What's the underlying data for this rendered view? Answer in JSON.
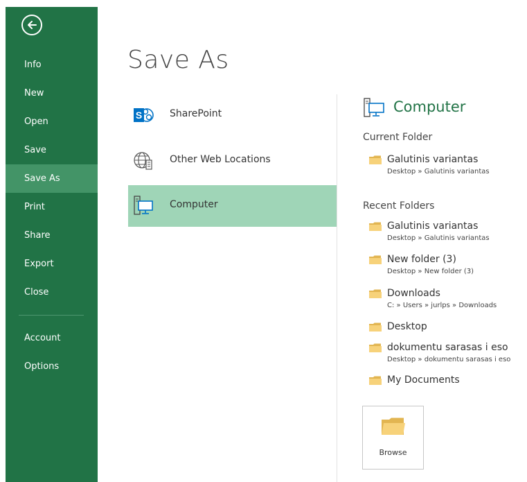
{
  "sidebar": {
    "items": [
      {
        "label": "Info",
        "active": false
      },
      {
        "label": "New",
        "active": false
      },
      {
        "label": "Open",
        "active": false
      },
      {
        "label": "Save",
        "active": false
      },
      {
        "label": "Save As",
        "active": true
      },
      {
        "label": "Print",
        "active": false
      },
      {
        "label": "Share",
        "active": false
      },
      {
        "label": "Export",
        "active": false
      },
      {
        "label": "Close",
        "active": false
      }
    ],
    "footer_items": [
      {
        "label": "Account"
      },
      {
        "label": "Options"
      }
    ],
    "back_icon": "back-arrow-icon",
    "color": "#217346",
    "active_color": "#439467"
  },
  "main": {
    "title": "Save As",
    "places": [
      {
        "label": "SharePoint",
        "icon": "sharepoint-icon",
        "selected": false
      },
      {
        "label": "Other Web Locations",
        "icon": "globe-icon",
        "selected": false
      },
      {
        "label": "Computer",
        "icon": "computer-icon",
        "selected": true
      }
    ],
    "selected_color": "#9fd5b7"
  },
  "details": {
    "title": "Computer",
    "current_folder_heading": "Current Folder",
    "current_folder": {
      "name": "Galutinis variantas",
      "path": "Desktop » Galutinis variantas"
    },
    "recent_heading": "Recent Folders",
    "recent_folders": [
      {
        "name": "Galutinis variantas",
        "path": "Desktop » Galutinis variantas"
      },
      {
        "name": "New folder (3)",
        "path": "Desktop » New folder (3)"
      },
      {
        "name": "Downloads",
        "path": "C: » Users » jurlps » Downloads"
      },
      {
        "name": "Desktop",
        "path": ""
      },
      {
        "name": "dokumentu sarasas i eso",
        "path": "Desktop » dokumentu sarasas i eso"
      },
      {
        "name": "My Documents",
        "path": ""
      }
    ],
    "browse_label": "Browse",
    "accent_color": "#217346"
  }
}
